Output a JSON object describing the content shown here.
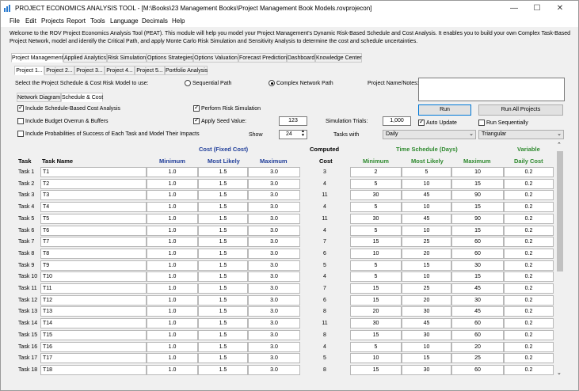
{
  "window": {
    "title": "PROJECT ECONOMICS ANALYSIS TOOL - [M:\\Books\\23 Management Books\\Project Management Book Models.rovprojecon]",
    "controls": [
      "—",
      "☐",
      "✕"
    ]
  },
  "menu": [
    "File",
    "Edit",
    "Projects",
    "Report",
    "Tools",
    "Language",
    "Decimals",
    "Help"
  ],
  "intro": "Welcome to the ROV Project Economics Analysis Tool (PEAT). This module will help you model your Project Management's Dynamic Risk-Based Schedule and Cost Analysis. It enables you to build your own Complex Task-Based Project Network, model and identify the Critical Path, and apply Monte Carlo Risk Simulation and Sensitivity Analysis to determine the cost and schedule uncertainties.",
  "main_tabs": [
    "Project Management",
    "Applied Analytics",
    "Risk Simulation",
    "Options Strategies",
    "Options Valuation",
    "Forecast Prediction",
    "Dashboard",
    "Knowledge Center"
  ],
  "project_tabs": [
    "Project 1...",
    "Project 2...",
    "Project 3...",
    "Project 4...",
    "Project 5...",
    "Portfolio Analysis"
  ],
  "sub_tabs": [
    "Network Diagram",
    "Schedule & Cost"
  ],
  "select_label": "Select the Project Schedule & Cost Risk Model to use:",
  "model_options": [
    "Sequential Path",
    "Complex Network Path"
  ],
  "project_notes_label": "Project Name/Notes:",
  "checks": {
    "schedule_cost": "Include Schedule-Based Cost Analysis",
    "budget_overrun": "Include Budget Overrun & Buffers",
    "prob_success": "Include Probabilities of Success of Each Task and Model Their Impacts",
    "risk_sim": "Perform Risk Simulation",
    "seed": "Apply Seed Value:",
    "auto_update": "Auto Update",
    "run_seq": "Run Sequentially"
  },
  "seed_value": "123",
  "sim_trials_label": "Simulation Trials:",
  "sim_trials": "1,000",
  "show_label": "Show",
  "show_value": "24",
  "tasks_with_label": "Tasks with",
  "tasks_with_value": "Daily",
  "distribution": "Triangular",
  "run_button": "Run",
  "run_all_button": "Run All Projects",
  "headers": {
    "cost_fixed": "Cost (Fixed Cost)",
    "computed": "Computed",
    "time_schedule": "Time Schedule (Days)",
    "variable": "Variable",
    "task": "Task",
    "task_name": "Task Name",
    "minimum": "Minimum",
    "most_likely": "Most Likely",
    "maximum": "Maximum",
    "cost": "Cost",
    "t_minimum": "Minimum",
    "t_most_likely": "Most Likely",
    "t_maximum": "Maximum",
    "daily_cost": "Daily Cost"
  },
  "rows": [
    {
      "task": "Task 1",
      "name": "T1",
      "min": "1.0",
      "ml": "1.5",
      "max": "3.0",
      "cost": "3",
      "tmin": "2",
      "tml": "5",
      "tmax": "10",
      "daily": "0.2"
    },
    {
      "task": "Task 2",
      "name": "T2",
      "min": "1.0",
      "ml": "1.5",
      "max": "3.0",
      "cost": "4",
      "tmin": "5",
      "tml": "10",
      "tmax": "15",
      "daily": "0.2"
    },
    {
      "task": "Task 3",
      "name": "T3",
      "min": "1.0",
      "ml": "1.5",
      "max": "3.0",
      "cost": "11",
      "tmin": "30",
      "tml": "45",
      "tmax": "90",
      "daily": "0.2"
    },
    {
      "task": "Task 4",
      "name": "T4",
      "min": "1.0",
      "ml": "1.5",
      "max": "3.0",
      "cost": "4",
      "tmin": "5",
      "tml": "10",
      "tmax": "15",
      "daily": "0.2"
    },
    {
      "task": "Task 5",
      "name": "T5",
      "min": "1.0",
      "ml": "1.5",
      "max": "3.0",
      "cost": "11",
      "tmin": "30",
      "tml": "45",
      "tmax": "90",
      "daily": "0.2"
    },
    {
      "task": "Task 6",
      "name": "T6",
      "min": "1.0",
      "ml": "1.5",
      "max": "3.0",
      "cost": "4",
      "tmin": "5",
      "tml": "10",
      "tmax": "15",
      "daily": "0.2"
    },
    {
      "task": "Task 7",
      "name": "T7",
      "min": "1.0",
      "ml": "1.5",
      "max": "3.0",
      "cost": "7",
      "tmin": "15",
      "tml": "25",
      "tmax": "60",
      "daily": "0.2"
    },
    {
      "task": "Task 8",
      "name": "T8",
      "min": "1.0",
      "ml": "1.5",
      "max": "3.0",
      "cost": "6",
      "tmin": "10",
      "tml": "20",
      "tmax": "60",
      "daily": "0.2"
    },
    {
      "task": "Task 9",
      "name": "T9",
      "min": "1.0",
      "ml": "1.5",
      "max": "3.0",
      "cost": "5",
      "tmin": "5",
      "tml": "15",
      "tmax": "30",
      "daily": "0.2"
    },
    {
      "task": "Task 10",
      "name": "T10",
      "min": "1.0",
      "ml": "1.5",
      "max": "3.0",
      "cost": "4",
      "tmin": "5",
      "tml": "10",
      "tmax": "15",
      "daily": "0.2"
    },
    {
      "task": "Task 11",
      "name": "T11",
      "min": "1.0",
      "ml": "1.5",
      "max": "3.0",
      "cost": "7",
      "tmin": "15",
      "tml": "25",
      "tmax": "45",
      "daily": "0.2"
    },
    {
      "task": "Task 12",
      "name": "T12",
      "min": "1.0",
      "ml": "1.5",
      "max": "3.0",
      "cost": "6",
      "tmin": "15",
      "tml": "20",
      "tmax": "30",
      "daily": "0.2"
    },
    {
      "task": "Task 13",
      "name": "T13",
      "min": "1.0",
      "ml": "1.5",
      "max": "3.0",
      "cost": "8",
      "tmin": "20",
      "tml": "30",
      "tmax": "45",
      "daily": "0.2"
    },
    {
      "task": "Task 14",
      "name": "T14",
      "min": "1.0",
      "ml": "1.5",
      "max": "3.0",
      "cost": "11",
      "tmin": "30",
      "tml": "45",
      "tmax": "60",
      "daily": "0.2"
    },
    {
      "task": "Task 15",
      "name": "T15",
      "min": "1.0",
      "ml": "1.5",
      "max": "3.0",
      "cost": "8",
      "tmin": "15",
      "tml": "30",
      "tmax": "60",
      "daily": "0.2"
    },
    {
      "task": "Task 16",
      "name": "T16",
      "min": "1.0",
      "ml": "1.5",
      "max": "3.0",
      "cost": "4",
      "tmin": "5",
      "tml": "10",
      "tmax": "20",
      "daily": "0.2"
    },
    {
      "task": "Task 17",
      "name": "T17",
      "min": "1.0",
      "ml": "1.5",
      "max": "3.0",
      "cost": "5",
      "tmin": "10",
      "tml": "15",
      "tmax": "25",
      "daily": "0.2"
    },
    {
      "task": "Task 18",
      "name": "T18",
      "min": "1.0",
      "ml": "1.5",
      "max": "3.0",
      "cost": "8",
      "tmin": "15",
      "tml": "30",
      "tmax": "60",
      "daily": "0.2"
    }
  ]
}
